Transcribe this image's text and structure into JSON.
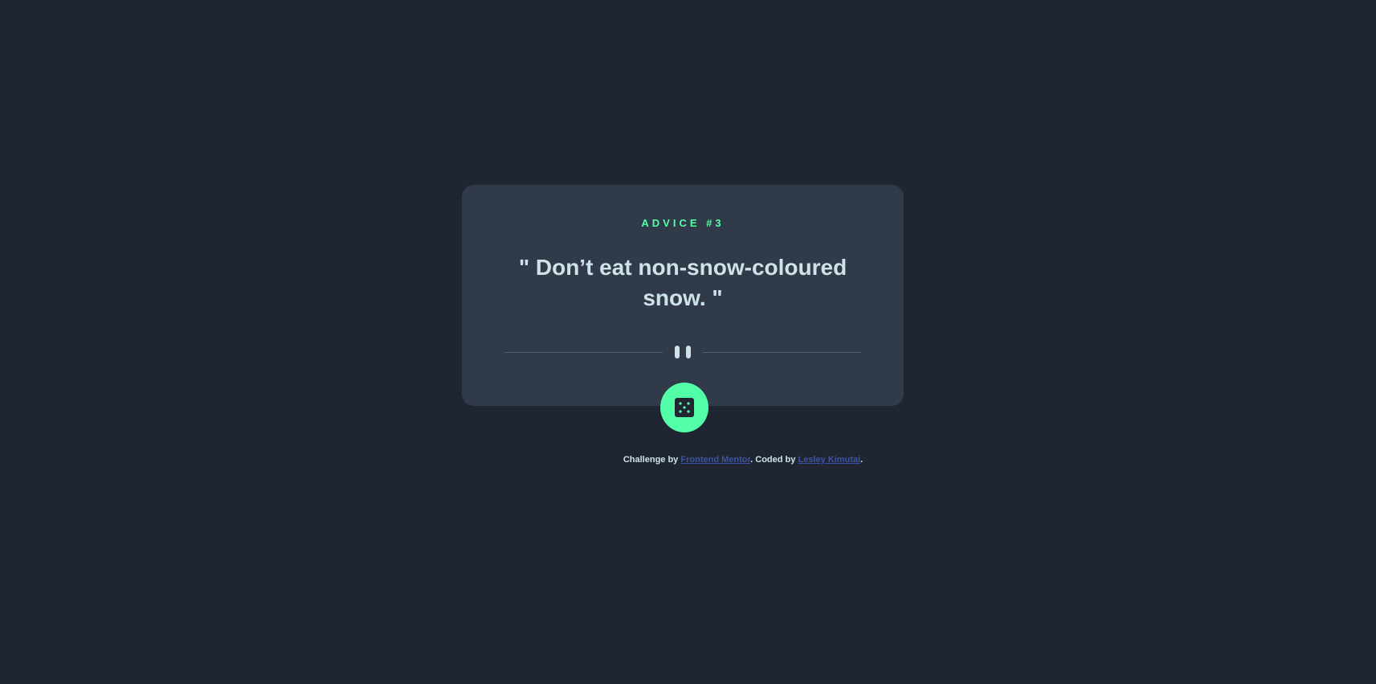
{
  "advice": {
    "label": "ADVICE #3",
    "quote": "\" Don’t eat non-snow-coloured snow. \""
  },
  "button": {
    "icon": "dice-icon"
  },
  "footer": {
    "prefix": "Challenge by ",
    "link1": "Frontend Mentor",
    "middle": ". Coded by ",
    "link2": "Lesley Kimutai",
    "suffix": "."
  },
  "colors": {
    "background": "#1f2632",
    "card": "#313a48",
    "accent": "#52ffa8",
    "text": "#cee3e9",
    "divider": "#4f5d74",
    "link": "#3e52a3"
  }
}
